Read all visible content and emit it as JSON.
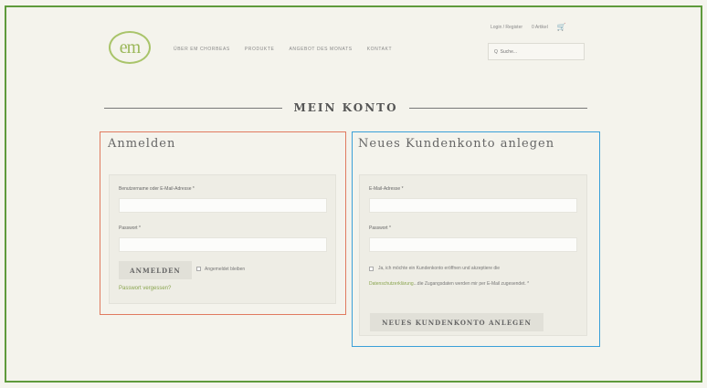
{
  "header": {
    "logo_text": "em",
    "nav": [
      "Über em Chorbeas",
      "Produkte",
      "Angebot des Monats",
      "Kontakt"
    ],
    "login_register": "Login / Register",
    "cart": "0 Artikel",
    "search_placeholder": "Q  Suche..."
  },
  "page": {
    "title": "MEIN KONTO"
  },
  "login": {
    "heading": "Anmelden",
    "username_label": "Benutzername oder E-Mail-Adresse *",
    "password_label": "Passwort *",
    "submit_label": "ANMELDEN",
    "remember_label": "Angemeldet bleiben",
    "lost_password": "Passwort vergessen?"
  },
  "register": {
    "heading": "Neues Kundenkonto anlegen",
    "email_label": "E-Mail-Adresse *",
    "password_label": "Passwort *",
    "terms_prefix": "Ja, ich möchte ein Kundenkonto eröffnen und akzeptiere die",
    "terms_link": "Datenschutzerklärung",
    "terms_suffix": "...die Zugangsdaten werden mir per E-Mail zugesendet. *",
    "submit_label": "NEUES KUNDENKONTO ANLEGEN"
  },
  "colors": {
    "frame_border": "#5f9a3c",
    "login_outline": "#e07a5f",
    "register_outline": "#3aa0d8",
    "link": "#8aa54f"
  }
}
